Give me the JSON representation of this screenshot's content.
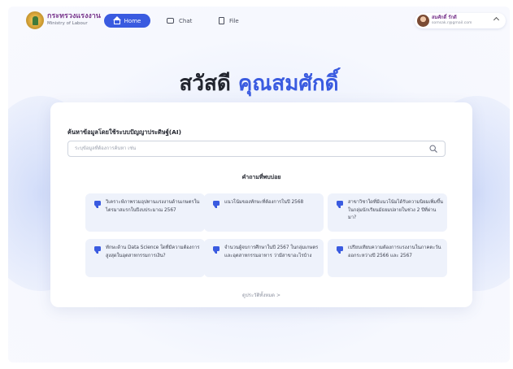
{
  "header": {
    "org_name_th": "กระทรวงแรงงาน",
    "org_name_en": "Ministry of Labour",
    "nav": {
      "home": "Home",
      "chat": "Chat",
      "file": "File"
    },
    "user": {
      "name": "สมศักดิ์ รักดี",
      "email": "somsak.r@gmail.com"
    }
  },
  "greeting": {
    "prefix": "สวัสดี",
    "name": "คุณสมศักดิ์"
  },
  "search": {
    "title": "ค้นหาข้อมูลโดยใช้ระบบปัญญาประดิษฐ์(AI)",
    "placeholder": "ระบุข้อมูลที่ต้องการค้นหา เช่น"
  },
  "faq": {
    "title": "คำถามที่พบบ่อย",
    "items": [
      "วิเคราะห์ภาพรวมอุปทานแรงงานด้านเกษตรในไตรมาสแรกในปีงบประมาณ 2567",
      "แนวโน้มของทักษะที่ต้องการในปี 2568",
      "สาขาวิชาใดที่มีแนวโน้มได้รับความนิยมเพิ่มขึ้นในกลุ่มนักเรียนมัธยมปลายในช่วง 2 ปีที่ผ่านมา?",
      "ทักษะด้าน Data Science ใดที่มีความต้องการสูงสุดในอุตสาหกรรมการเงิน?",
      "จำนวนผู้จบการศึกษาในปี 2567 ในกลุ่มเกษตรและอุตสาหกรรมอาหาร ว่ามีสาขาอะไรบ้าง",
      "เปรียบเทียบความต้องการแรงงานในภาคตะวันออกระหว่างปี 2566 และ 2567"
    ],
    "view_all": "ดูประวัติทั้งหมด  >"
  },
  "colors": {
    "accent": "#3a5be0",
    "org": "#7b3a8f"
  }
}
